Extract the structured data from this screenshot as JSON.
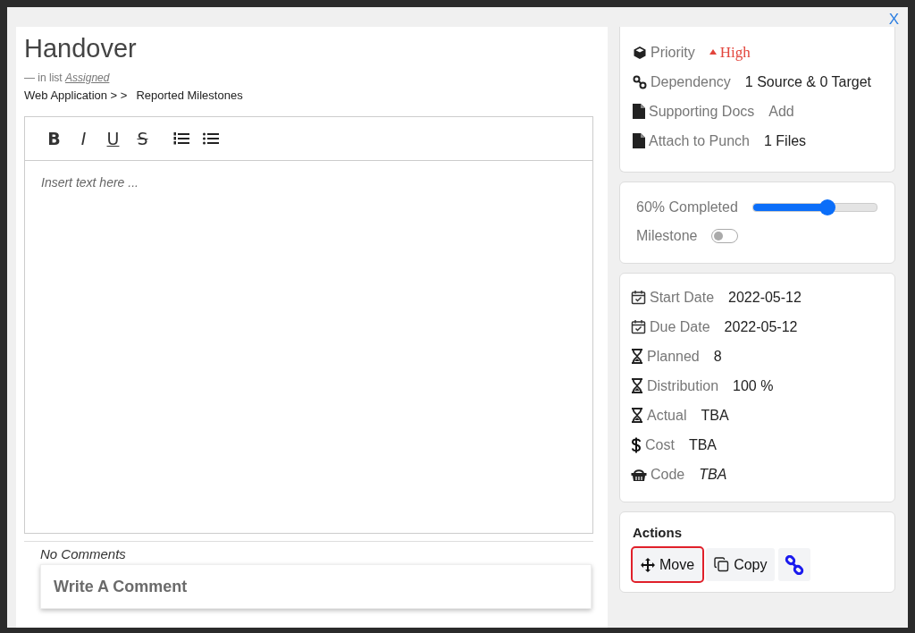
{
  "close": "X",
  "title": "Handover",
  "list_prefix": "—  in list",
  "list_name": "Assigned",
  "breadcrumb": [
    "Web Application > >",
    "Reported Milestones"
  ],
  "toolbar": [
    {
      "kind": "bold",
      "label": "B"
    },
    {
      "kind": "italic",
      "label": "I"
    },
    {
      "kind": "underline",
      "label": "U"
    },
    {
      "kind": "strike",
      "label": "S"
    },
    {
      "kind": "ordered-list"
    },
    {
      "kind": "bullet-list"
    }
  ],
  "editor": {
    "placeholder": "Insert text here ..."
  },
  "comments": {
    "status": "No Comments",
    "placeholder": "Write A Comment"
  },
  "details": [
    {
      "kind": "priority",
      "label": "Priority",
      "value": "High"
    },
    {
      "kind": "dependency",
      "label": "Dependency",
      "value": "1 Source & 0 Target"
    },
    {
      "kind": "docs",
      "label": "Supporting Docs",
      "value": "Add"
    },
    {
      "kind": "attachment",
      "label": "Attach to Punch",
      "value": "1 Files"
    }
  ],
  "progress": {
    "label": "60% Completed",
    "level": 0.6
  },
  "milestone": {
    "label": "Milestone",
    "on": false
  },
  "schedule": [
    {
      "kind": "date",
      "label": "Start Date",
      "value": "2022-05-12"
    },
    {
      "kind": "date",
      "label": "Due Date",
      "value": "2022-05-12"
    },
    {
      "kind": "hours",
      "label": "Planned",
      "value": "8"
    },
    {
      "kind": "hours",
      "label": "Distribution",
      "value": "100 %"
    },
    {
      "kind": "hours",
      "label": "Actual",
      "value": "TBA"
    },
    {
      "kind": "cost",
      "label": "Cost",
      "value": "TBA"
    },
    {
      "kind": "code",
      "label": "Code",
      "value": "TBA"
    }
  ],
  "actions": {
    "title": "Actions",
    "buttons": [
      {
        "kind": "move",
        "label": "Move",
        "highlighted": true
      },
      {
        "kind": "copy",
        "label": "Copy",
        "highlighted": false
      },
      {
        "kind": "link",
        "highlighted": false
      }
    ]
  }
}
